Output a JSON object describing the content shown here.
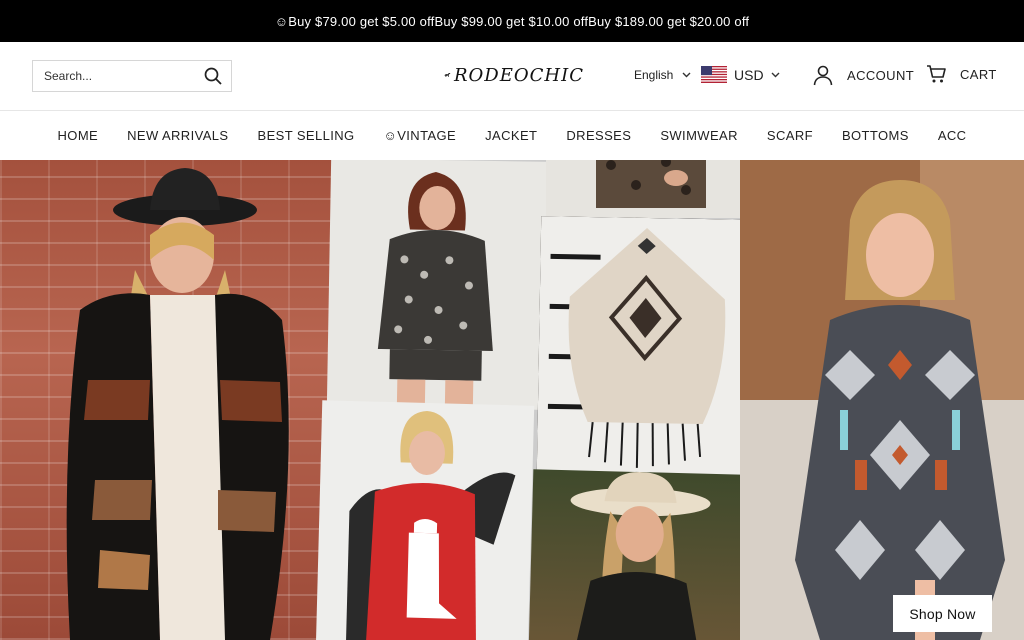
{
  "announcement": "☺Buy $79.00 get $5.00 offBuy $99.00 get $10.00 offBuy $189.00 get $20.00 off",
  "search": {
    "placeholder": "Search..."
  },
  "logo": {
    "text": "RODEOCHIC"
  },
  "language": {
    "selected": "English"
  },
  "currency": {
    "selected": "USD"
  },
  "account_label": "ACCOUNT",
  "cart_label": "CART",
  "nav": [
    "HOME",
    "NEW ARRIVALS",
    "BEST SELLING",
    "☺VINTAGE",
    "JACKET",
    "DRESSES",
    "SWIMWEAR",
    "SCARF",
    "BOTTOMS",
    "ACC"
  ],
  "hero": {
    "cta": "Shop Now"
  },
  "icons": [
    "search-icon",
    "chevron-down-icon",
    "us-flag-icon",
    "user-icon",
    "cart-icon",
    "horse-icon"
  ],
  "colors": {
    "announcement_bg": "#000000",
    "text": "#222222",
    "border": "#e6e6e6"
  }
}
